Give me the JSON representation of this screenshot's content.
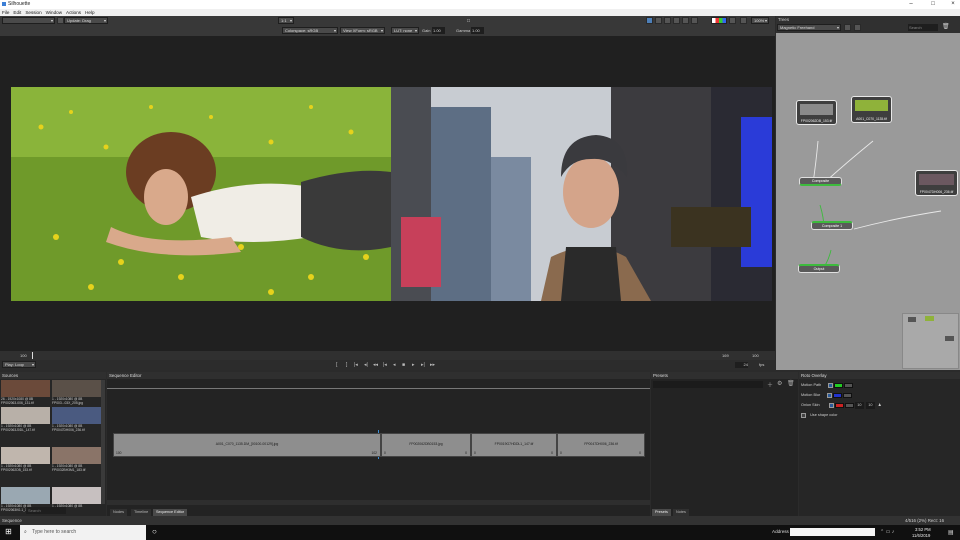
{
  "app": {
    "title": "Silhouette"
  },
  "menu": [
    "File",
    "Edit",
    "Session",
    "Window",
    "Actions",
    "Help"
  ],
  "toolbar": {
    "update_label": "Update: Drag",
    "zoom": "1:1",
    "colorspace": "Colorspace: sRGB",
    "view_xform": "View XForm: sRGB",
    "lut": "LUT: none",
    "gain_label": "Gain",
    "gain_value": "1.00",
    "gamma_label": "Gamma",
    "gamma_value": "1.00",
    "viewer_zoom": "100%"
  },
  "transport": {
    "start_frame": "100",
    "end_frame": "169",
    "current_frame": "100",
    "loop_mode": "Play: Loop",
    "fps_value": "24",
    "fps_label": "fps"
  },
  "trees": {
    "title": "Trees",
    "tree_name": "Magnetic Freehand",
    "search_placeholder": "Search",
    "nodes": [
      {
        "label": "FP002062DB_153.tif"
      },
      {
        "label": "A001_C070_1135.tif"
      },
      {
        "label": "FP0047DH006_236.tif"
      }
    ],
    "comp_nodes": [
      "Composite",
      "Composite 1",
      "Output"
    ]
  },
  "sources": {
    "title": "Sources",
    "items": [
      {
        "line1": "26 - 1920x1080 @ 8B",
        "line2": "FP002063-006_131.tif"
      },
      {
        "line1": "1 - 1920x1080 @ 8B",
        "line2": "FP003...03X_205.jpg"
      },
      {
        "line1": "1 - 1920x1080 @ 8B",
        "line2": "FP002063J0DL_147.tif"
      },
      {
        "line1": "1 - 1920x1080 @ 8B",
        "line2": "FP0047DH006_236.tif"
      },
      {
        "line1": "1 - 1920x1080 @ 8B",
        "line2": "FP002062DB_153.tif"
      },
      {
        "line1": "1 - 1920x1080 @ 8B",
        "line2": "FP0032BH3M1_183.tif"
      },
      {
        "line1": "1 - 1920x1080 @ 8B",
        "line2": "FP002063K0-1_115.tif"
      },
      {
        "line1": "1 - 1920x1080 @ 8B",
        "line2": ""
      }
    ],
    "search_placeholder": "Search"
  },
  "sequence": {
    "title": "Sequence Editor",
    "clips": [
      {
        "name": "A001_C070_1135.DM_[00100-00129].jpg",
        "in": "100",
        "out": "102"
      },
      {
        "name": "FP002062DB0153.jpg",
        "in": "0",
        "out": "0"
      },
      {
        "name": "FP0019G7HDDL1_147.tif",
        "in": "0",
        "out": "0"
      },
      {
        "name": "FP0047DH006_236.tif",
        "in": "0",
        "out": "0"
      }
    ],
    "tabs": [
      "Nodes",
      "Timeline",
      "Sequence Editor"
    ]
  },
  "presets": {
    "title": "Presets",
    "tabs": [
      "Presets",
      "Notes"
    ]
  },
  "roto": {
    "title": "Roto Overlay",
    "rows": [
      {
        "label": "Motion Path",
        "color": "#22cc22"
      },
      {
        "label": "Motion Blur",
        "color": "#2233cc"
      },
      {
        "label": "Onion Skin",
        "color": "#cc2222"
      }
    ],
    "onion_a": "10",
    "onion_b": "10",
    "use_shape_color": "Use shape color"
  },
  "status": {
    "left": "Sequence",
    "right": "4/516 (2%) Rect: 16"
  },
  "taskbar": {
    "search_placeholder": "Type here to search",
    "address_label": "Address",
    "time": "3:52 PM",
    "date": "11/6/2019"
  }
}
